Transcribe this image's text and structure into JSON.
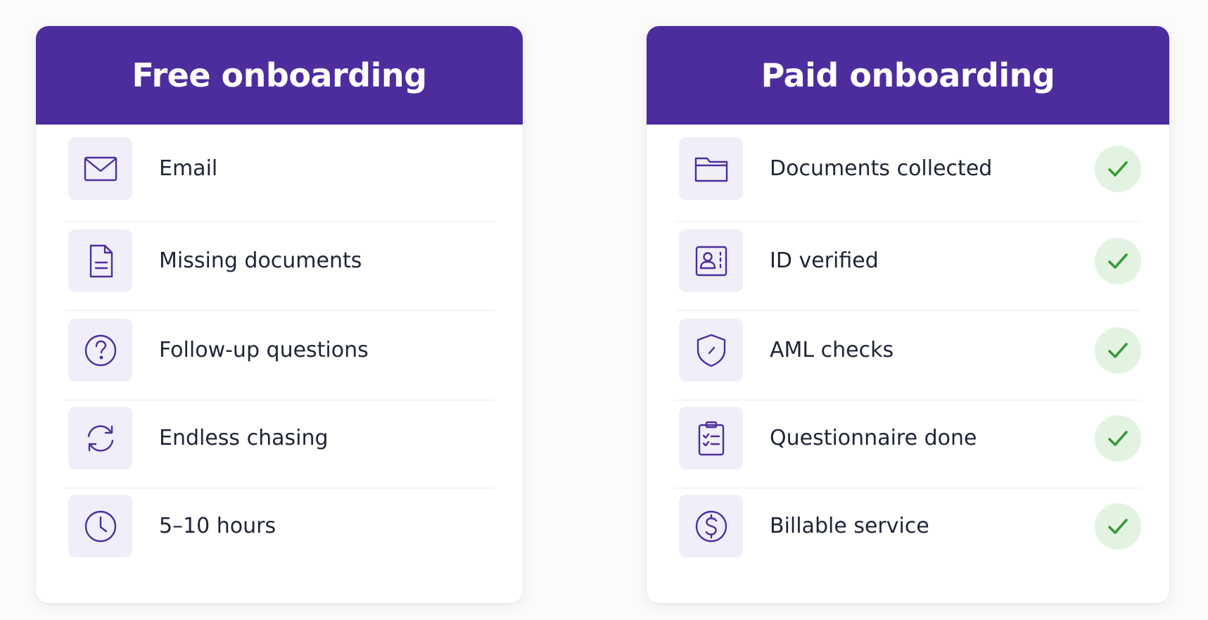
{
  "colors": {
    "header_bg": "#4d2d9e",
    "icon_stroke": "#4d2d9e",
    "icon_tile_bg": "#f0eef8",
    "check_green": "#3a9a3a",
    "check_bg": "#e3f3e1"
  },
  "free": {
    "title": "Free onboarding",
    "items": [
      {
        "label": "Email",
        "icon": "envelope-icon"
      },
      {
        "label": "Missing documents",
        "icon": "document-icon"
      },
      {
        "label": "Follow-up questions",
        "icon": "question-circle-icon"
      },
      {
        "label": "Endless chasing",
        "icon": "refresh-cycle-icon"
      },
      {
        "label": "5–10 hours",
        "icon": "clock-icon"
      }
    ]
  },
  "paid": {
    "title": "Paid onboarding",
    "items": [
      {
        "label": "Documents collected",
        "icon": "folder-icon",
        "checked": true
      },
      {
        "label": "ID verified",
        "icon": "id-card-icon",
        "checked": true
      },
      {
        "label": "AML checks",
        "icon": "shield-icon",
        "checked": true
      },
      {
        "label": "Questionnaire done",
        "icon": "clipboard-checklist-icon",
        "checked": true
      },
      {
        "label": "Billable service",
        "icon": "dollar-circle-icon",
        "checked": true
      }
    ]
  }
}
